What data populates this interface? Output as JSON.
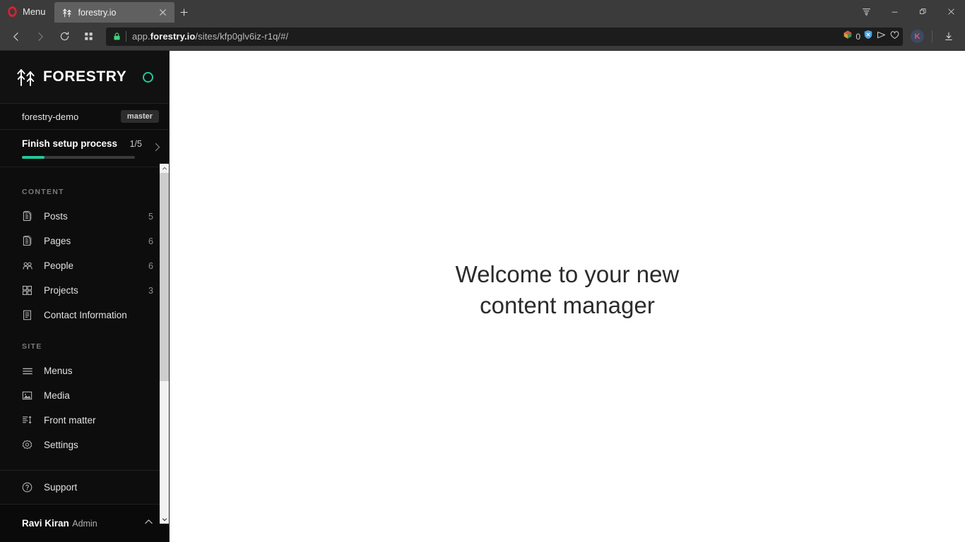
{
  "browser": {
    "name": "Opera",
    "menu_label": "Menu",
    "menu_icon": "opera-o-icon",
    "tabs": [
      {
        "title": "forestry.io",
        "favicon": "forestry-tree-icon",
        "active": true,
        "close_icon": "close-icon"
      }
    ],
    "new_tab_icon": "plus-icon",
    "window_controls": [
      {
        "name": "window-extra-menu",
        "icon": "sliders-icon"
      },
      {
        "name": "window-minimize",
        "icon": "minimize-icon"
      },
      {
        "name": "window-maximize",
        "icon": "restore-icon"
      },
      {
        "name": "window-close",
        "icon": "close-icon"
      }
    ],
    "toolbar": {
      "back_icon": "chevron-left-icon",
      "forward_icon": "chevron-right-icon",
      "reload_icon": "reload-icon",
      "speed_dial_icon": "grid-icon",
      "security_icon": "lock-icon",
      "url_prefix": "app.",
      "url_domain": "forestry.io",
      "url_path": "/sites/kfp0glv6iz-r1q/#/",
      "url_full": "app.forestry.io/sites/kfp0glv6iz-r1q/#/",
      "cube_icon": "3d-cube-icon",
      "blocked_count": "0",
      "adblock_icon": "adblock-shield-icon",
      "messenger_icon": "send-icon",
      "heart_icon": "heart-icon",
      "profile_initial": "K",
      "downloads_icon": "download-icon"
    }
  },
  "sidebar": {
    "brand": {
      "logo_icon": "forestry-tree-icon",
      "name": "FORESTRY",
      "status_icon": "status-ring-icon"
    },
    "site": {
      "name": "forestry-demo",
      "branch": "master"
    },
    "setup": {
      "label": "Finish setup process",
      "progress_text": "1/5",
      "progress_percent": 20,
      "chevron_icon": "chevron-right-icon",
      "accent_color": "#22c79a"
    },
    "groups": [
      {
        "title": "CONTENT",
        "items": [
          {
            "label": "Posts",
            "count": "5",
            "icon": "document-copy-icon"
          },
          {
            "label": "Pages",
            "count": "6",
            "icon": "document-copy-icon"
          },
          {
            "label": "People",
            "count": "6",
            "icon": "people-icon"
          },
          {
            "label": "Projects",
            "count": "3",
            "icon": "grid-squares-icon"
          },
          {
            "label": "Contact Information",
            "count": "",
            "icon": "document-lines-icon"
          }
        ]
      },
      {
        "title": "SITE",
        "items": [
          {
            "label": "Menus",
            "count": "",
            "icon": "hamburger-icon"
          },
          {
            "label": "Media",
            "count": "",
            "icon": "image-icon"
          },
          {
            "label": "Front matter",
            "count": "",
            "icon": "sort-lines-icon"
          },
          {
            "label": "Settings",
            "count": "",
            "icon": "gear-icon"
          }
        ]
      }
    ],
    "support": {
      "label": "Support",
      "icon": "question-circle-icon"
    },
    "user": {
      "name": "Ravi Kiran",
      "role": "Admin",
      "chevron_icon": "chevron-up-icon"
    },
    "scrollbar": {
      "up_icon": "chevron-up-icon",
      "down_icon": "chevron-down-icon"
    }
  },
  "main": {
    "welcome_line1": "Welcome to your new",
    "welcome_line2": "content manager"
  }
}
